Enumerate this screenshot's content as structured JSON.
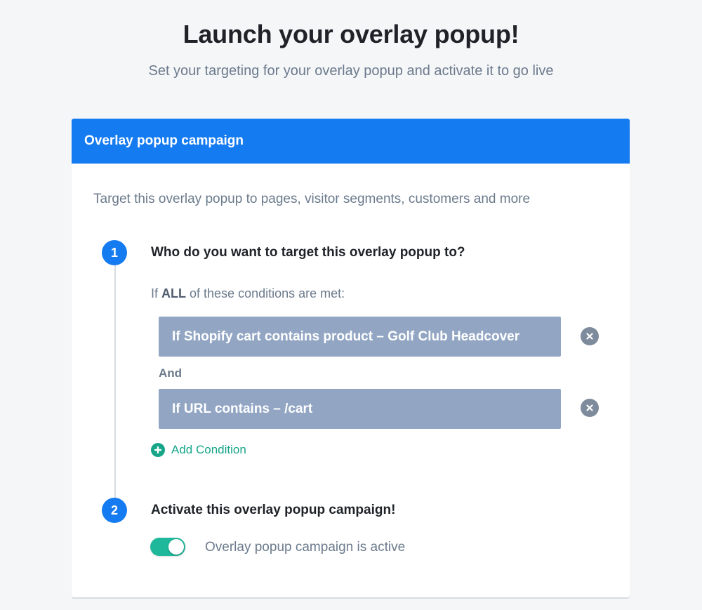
{
  "header": {
    "title": "Launch your overlay popup!",
    "subtitle": "Set your targeting for your overlay popup and activate it to go live"
  },
  "card": {
    "heading": "Overlay popup campaign",
    "intro": "Target this overlay popup to pages, visitor segments, customers and more"
  },
  "step1": {
    "number": "1",
    "title": "Who do you want to target this overlay popup to?",
    "condition_intro_prefix": "If ",
    "condition_intro_bold": "ALL",
    "condition_intro_suffix": " of these conditions are met:",
    "conditions": [
      {
        "label": "If Shopify cart contains product – Golf Club Headcover",
        "remove_icon": "close-circle-icon"
      },
      {
        "label": "If URL contains – /cart",
        "remove_icon": "close-circle-icon"
      }
    ],
    "joiner": "And",
    "add_condition_label": "Add Condition",
    "add_condition_icon": "plus-circle-icon"
  },
  "step2": {
    "number": "2",
    "title": "Activate this overlay popup campaign!",
    "toggle_on": true,
    "toggle_label": "Overlay popup campaign is active"
  },
  "colors": {
    "accent": "#157bf0",
    "condition_bg": "#92a6c4",
    "success": "#17a589",
    "toggle_on": "#1fb89a"
  }
}
